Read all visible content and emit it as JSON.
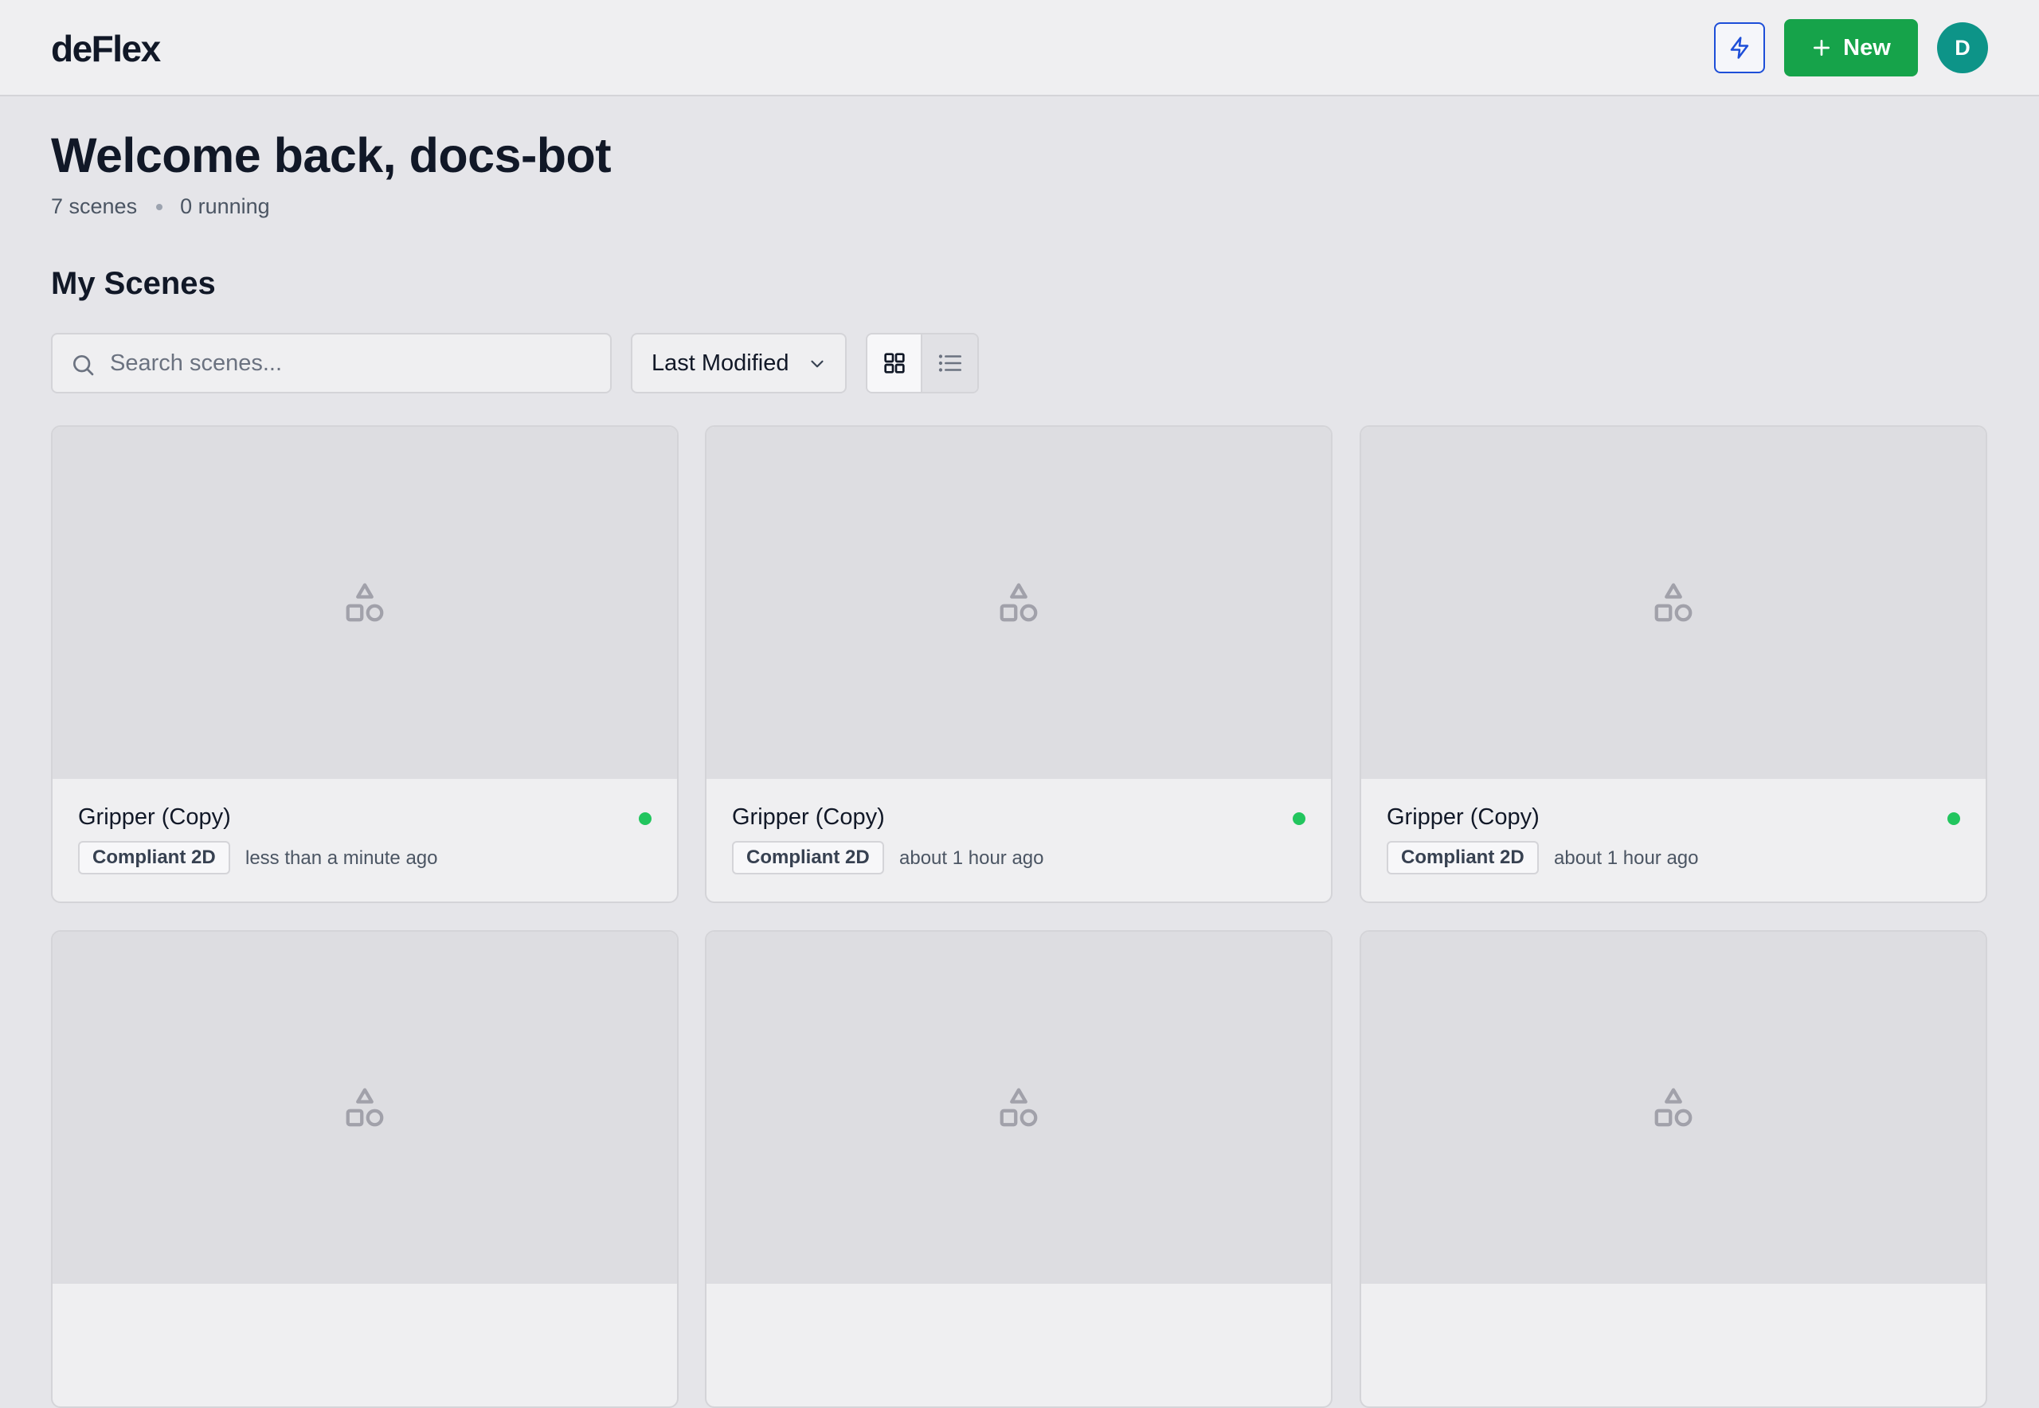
{
  "header": {
    "logo": "deFlex",
    "new_button_label": "New",
    "avatar_initial": "D"
  },
  "welcome": {
    "title": "Welcome back, docs-bot",
    "scenes_count": "7 scenes",
    "running_count": "0 running"
  },
  "section": {
    "title": "My Scenes"
  },
  "toolbar": {
    "search_placeholder": "Search scenes...",
    "search_value": "",
    "sort_label": "Last Modified",
    "active_view": "grid"
  },
  "colors": {
    "accent_green": "#16a34a",
    "avatar_teal": "#0d9488",
    "status_green": "#22c55e",
    "bolt_blue": "#1d4ed8"
  },
  "scenes": [
    {
      "name": "Gripper (Copy)",
      "tag": "Compliant 2D",
      "modified": "less than a minute ago"
    },
    {
      "name": "Gripper (Copy)",
      "tag": "Compliant 2D",
      "modified": "about 1 hour ago"
    },
    {
      "name": "Gripper (Copy)",
      "tag": "Compliant 2D",
      "modified": "about 1 hour ago"
    }
  ]
}
